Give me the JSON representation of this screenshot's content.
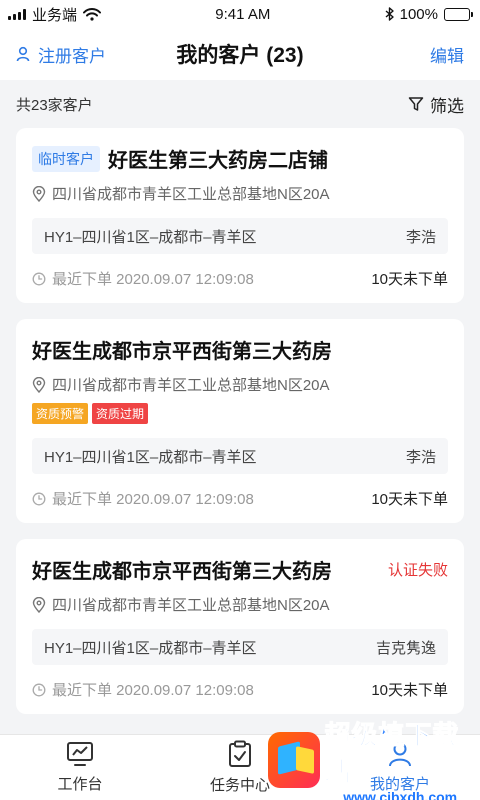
{
  "status_bar": {
    "carrier": "业务端",
    "time": "9:41 AM",
    "battery": "100%"
  },
  "nav": {
    "left_label": "注册客户",
    "title": "我的客户 (23)",
    "right_label": "编辑"
  },
  "summary": {
    "count_text": "共23家客户",
    "filter_label": "筛选"
  },
  "customers": [
    {
      "tag": "临时客户",
      "name": "好医生第三大药房二店铺",
      "address": "四川省成都市青羊区工业总部基地N区20A",
      "region": "HY1–四川省1区–成都市–青羊区",
      "rep": "李浩",
      "last_order": "最近下单  2020.09.07 12:09:08",
      "no_order": "10天未下单"
    },
    {
      "name": "好医生成都市京平西街第三大药房",
      "address": "四川省成都市青羊区工业总部基地N区20A",
      "tags": [
        "资质预警",
        "资质过期"
      ],
      "region": "HY1–四川省1区–成都市–青羊区",
      "rep": "李浩",
      "last_order": "最近下单  2020.09.07 12:09:08",
      "no_order": "10天未下单"
    },
    {
      "name": "好医生成都市京平西街第三大药房",
      "status": "认证失败",
      "address": "四川省成都市青羊区工业总部基地N区20A",
      "region": "HY1–四川省1区–成都市–青羊区",
      "rep": "吉克隽逸",
      "last_order": "最近下单  2020.09.07 12:09:08",
      "no_order": "10天未下单"
    }
  ],
  "tabbar": [
    {
      "label": "工作台",
      "icon": "monitor-chart-icon"
    },
    {
      "label": "任务中心",
      "icon": "clipboard-check-icon"
    },
    {
      "label": "我的客户",
      "icon": "customer-icon"
    }
  ],
  "watermark": {
    "title": "超级植下载站",
    "url": "www.cjbxdh.com"
  },
  "colors": {
    "accent": "#2f7be5",
    "danger": "#e53535",
    "warn": "#f5a623",
    "background": "#f3f4f6"
  }
}
